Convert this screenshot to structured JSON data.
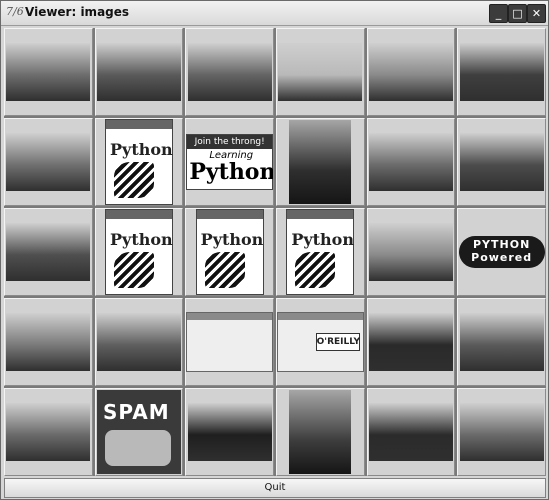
{
  "window": {
    "title": "Viewer: images",
    "app_icon": "7/6"
  },
  "controls": {
    "minimize": "_",
    "maximize": "□",
    "close": "✕"
  },
  "thumbnails": [
    {
      "name": "thumb-castle-1",
      "kind": "photo",
      "tone": "#6d6d6d"
    },
    {
      "name": "thumb-castle-2",
      "kind": "photo",
      "tone": "#5a5a5a"
    },
    {
      "name": "thumb-cathedral",
      "kind": "photo",
      "tone": "#646464"
    },
    {
      "name": "thumb-beach-birds",
      "kind": "photo",
      "tone": "#b9b9b9"
    },
    {
      "name": "thumb-sunset-sea",
      "kind": "photo",
      "tone": "#8a8a8a"
    },
    {
      "name": "thumb-sunset-dark",
      "kind": "photo",
      "tone": "#3f3f3f"
    },
    {
      "name": "thumb-mountain-valley",
      "kind": "photo",
      "tone": "#707070"
    },
    {
      "name": "thumb-python-book-1",
      "kind": "python_book"
    },
    {
      "name": "thumb-learning-python",
      "kind": "learning_python"
    },
    {
      "name": "thumb-clock-tower",
      "kind": "photo_portrait",
      "tone": "#2f2f2f"
    },
    {
      "name": "thumb-park-trees",
      "kind": "photo",
      "tone": "#6b6b6b"
    },
    {
      "name": "thumb-street-buildings",
      "kind": "photo",
      "tone": "#4c4c4c"
    },
    {
      "name": "thumb-bird-nest",
      "kind": "photo",
      "tone": "#4f4f4f"
    },
    {
      "name": "thumb-python-book-2",
      "kind": "python_book"
    },
    {
      "name": "thumb-python-book-3",
      "kind": "python_book"
    },
    {
      "name": "thumb-python-book-4",
      "kind": "python_book"
    },
    {
      "name": "thumb-tropical-beach",
      "kind": "photo",
      "tone": "#8a8a8a"
    },
    {
      "name": "thumb-python-powered",
      "kind": "python_logo"
    },
    {
      "name": "thumb-rocky-slope",
      "kind": "photo",
      "tone": "#7a7a7a"
    },
    {
      "name": "thumb-snowy-mountains",
      "kind": "photo",
      "tone": "#5f5f5f"
    },
    {
      "name": "thumb-web-page",
      "kind": "web_page"
    },
    {
      "name": "thumb-oreilly-page",
      "kind": "oreilly_page"
    },
    {
      "name": "thumb-night-cathedral",
      "kind": "photo",
      "tone": "#2a2a2a"
    },
    {
      "name": "thumb-marina",
      "kind": "photo",
      "tone": "#5a5a5a"
    },
    {
      "name": "thumb-palace",
      "kind": "photo",
      "tone": "#6a6a6a"
    },
    {
      "name": "thumb-spam-can",
      "kind": "spam"
    },
    {
      "name": "thumb-night-skyline",
      "kind": "photo",
      "tone": "#1f1f1f"
    },
    {
      "name": "thumb-pda-hand",
      "kind": "photo_portrait",
      "tone": "#3d3d3d"
    },
    {
      "name": "thumb-laptop-device",
      "kind": "photo",
      "tone": "#2b2b2b"
    },
    {
      "name": "thumb-penguin",
      "kind": "photo",
      "tone": "#6a6a6a"
    }
  ],
  "python_book": {
    "brand": "Python"
  },
  "learning_python": {
    "top": "Join the throng!",
    "mid": "Learning",
    "big": "Python"
  },
  "python_logo": {
    "line1": "PYTHON",
    "line2": "Powered"
  },
  "spam": {
    "word": "SPAM"
  },
  "oreilly": {
    "banner": "O'REILLY"
  },
  "quit_button": {
    "label": "Quit"
  }
}
